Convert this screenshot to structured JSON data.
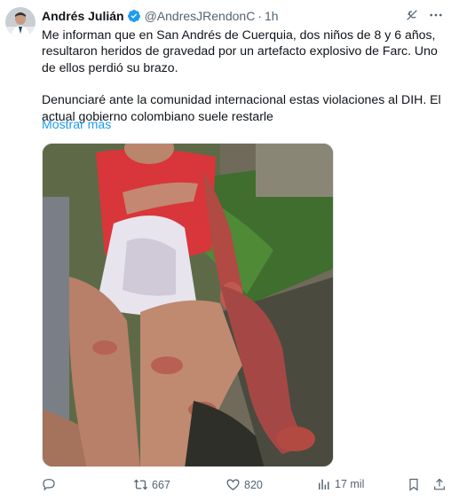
{
  "author": {
    "name": "Andrés Julián",
    "handle": "@AndresJRendonC",
    "separator": "·",
    "time": "1h",
    "avatar_icon": "profile-photo-icon",
    "verified_color": "#1d9bf0"
  },
  "tweet": {
    "paragraph1": "Me informan que en San Andrés de Cuerquia, dos niños de 8 y 6 años, resultaron heridos de gravedad por un artefacto explosivo de Farc. Uno de ellos perdió su brazo.",
    "paragraph2": "Denunciaré ante la comunidad internacional estas violaciones al DIH. El actual gobierno colombiano suele restarle",
    "show_more": "Mostrar más"
  },
  "actions": {
    "reply": {
      "icon": "reply-icon",
      "count": ""
    },
    "retweet": {
      "icon": "retweet-icon",
      "count": "667"
    },
    "like": {
      "icon": "heart-icon",
      "count": "820"
    },
    "views": {
      "icon": "views-icon",
      "count": "17 mil"
    },
    "bookmark": {
      "icon": "bookmark-icon"
    },
    "share": {
      "icon": "share-icon"
    }
  },
  "colors": {
    "text": "#0f1419",
    "secondary": "#536471",
    "link": "#1d9bf0"
  }
}
